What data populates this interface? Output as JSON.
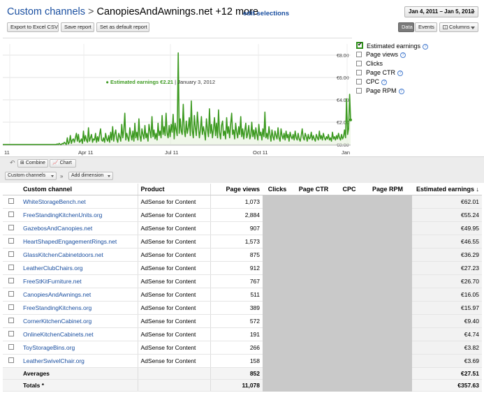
{
  "header": {
    "breadcrumb_root": "Custom channels",
    "breadcrumb_sep": ">",
    "breadcrumb_current": "CanopiesAndAwnings.net +12 more",
    "edit_link": "edit selections",
    "date_range": "Jan 4, 2011 – Jan 5, 2012"
  },
  "toolbar": {
    "export_label": "Export to Excel CSV",
    "save_label": "Save report",
    "default_label": "Set as default report",
    "data_tab": "Data",
    "events_tab": "Events",
    "columns_label": "Columns"
  },
  "chart_legend": {
    "metric": "● Estimated earnings €2.21",
    "date": "| January 3, 2012"
  },
  "metrics": [
    {
      "label": "Estimated earnings",
      "checked": true,
      "help": true
    },
    {
      "label": "Page views",
      "checked": false,
      "help": true
    },
    {
      "label": "Clicks",
      "checked": false,
      "help": false
    },
    {
      "label": "Page CTR",
      "checked": false,
      "help": true
    },
    {
      "label": "CPC",
      "checked": false,
      "help": true
    },
    {
      "label": "Page RPM",
      "checked": false,
      "help": true
    }
  ],
  "toolbar2": {
    "combine_label": "Combine",
    "chart_label": "Chart",
    "dimension_label": "Custom channels",
    "add_dimension_label": "Add dimension",
    "arrow": "»"
  },
  "table": {
    "columns": [
      "Custom channel",
      "Product",
      "Page views",
      "Clicks",
      "Page CTR",
      "CPC",
      "Page RPM",
      "Estimated earnings ↓"
    ],
    "rows": [
      {
        "channel": "WhiteStorageBench.net",
        "product": "AdSense for Content",
        "views": "1,073",
        "earnings": "€62.01"
      },
      {
        "channel": "FreeStandingKitchenUnits.org",
        "product": "AdSense for Content",
        "views": "2,884",
        "earnings": "€55.24"
      },
      {
        "channel": "GazebosAndCanopies.net",
        "product": "AdSense for Content",
        "views": "907",
        "earnings": "€49.95"
      },
      {
        "channel": "HeartShapedEngagementRings.net",
        "product": "AdSense for Content",
        "views": "1,573",
        "earnings": "€46.55"
      },
      {
        "channel": "GlassKitchenCabinetdoors.net",
        "product": "AdSense for Content",
        "views": "875",
        "earnings": "€36.29"
      },
      {
        "channel": "LeatherClubChairs.org",
        "product": "AdSense for Content",
        "views": "912",
        "earnings": "€27.23"
      },
      {
        "channel": "FreeStKitFurniture.net",
        "product": "AdSense for Content",
        "views": "767",
        "earnings": "€26.70"
      },
      {
        "channel": "CanopiesAndAwnings.net",
        "product": "AdSense for Content",
        "views": "511",
        "earnings": "€16.05"
      },
      {
        "channel": "FreeStandingKitchens.org",
        "product": "AdSense for Content",
        "views": "389",
        "earnings": "€15.97"
      },
      {
        "channel": "CornerKitchenCabinet.org",
        "product": "AdSense for Content",
        "views": "572",
        "earnings": "€9.40"
      },
      {
        "channel": "OnlineKitchenCabinets.net",
        "product": "AdSense for Content",
        "views": "191",
        "earnings": "€4.74"
      },
      {
        "channel": "ToyStorageBins.org",
        "product": "AdSense for Content",
        "views": "266",
        "earnings": "€3.82"
      },
      {
        "channel": "LeatherSwivelChair.org",
        "product": "AdSense for Content",
        "views": "158",
        "earnings": "€3.69"
      }
    ],
    "averages": {
      "label": "Averages",
      "views": "852",
      "earnings": "€27.51"
    },
    "totals": {
      "label": "Totals *",
      "views": "11,078",
      "earnings": "€357.63"
    }
  },
  "chart_data": {
    "type": "area",
    "title": "",
    "xlabel": "",
    "ylabel": "",
    "x_tick_labels": [
      "11",
      "Apr 11",
      "Jul 11",
      "Oct 11",
      "Jan"
    ],
    "y_tick_labels": [
      "€0.00",
      "€2.00",
      "€4.00",
      "€6.00",
      "€8.00"
    ],
    "ylim": [
      0,
      9
    ],
    "grid": true,
    "series": [
      {
        "values": [
          0,
          0,
          0,
          0,
          0,
          0,
          0,
          0,
          0,
          0,
          0,
          0,
          0,
          0,
          0,
          0,
          0,
          0,
          0,
          0,
          0,
          0,
          0,
          0,
          0,
          0,
          0,
          0,
          0,
          0,
          0,
          0,
          0,
          0,
          0,
          0,
          0,
          0,
          0,
          0,
          0,
          0,
          0,
          0,
          0,
          0,
          0,
          0,
          0,
          0,
          0,
          0,
          0,
          0,
          0.05,
          0,
          0.1,
          0,
          0,
          0.1,
          0.05,
          0.2,
          0.1,
          0,
          0.6,
          0.05,
          0.2,
          0.8,
          0.1,
          0.4,
          0.5,
          0.2,
          0.6,
          1.0,
          0.3,
          0.9,
          0.2,
          0.3,
          0.5,
          0.1,
          1.2,
          0.3,
          0.8,
          0.4,
          0.2,
          1.5,
          0.3,
          0.6,
          0.9,
          0.2,
          0.5,
          0.4,
          1.0,
          0.2,
          0.7,
          0.3,
          0.9,
          1.4,
          0.4,
          0.3,
          0.6,
          0.2,
          1.0,
          0.5,
          0.3,
          0.8,
          0.2,
          1.1,
          0.4,
          1.6,
          0.3,
          0.9,
          1.3,
          0.5,
          0.2,
          1.0,
          0.7,
          0.3,
          1.8,
          0.6,
          1.2,
          2.8,
          0.4,
          1.0,
          0.6,
          0.3,
          1.5,
          0.9,
          0.4,
          1.2,
          0.3,
          1.9,
          0.6,
          1.1,
          0.4,
          2.3,
          0.8,
          0.3,
          1.4,
          0.9,
          0.5,
          1.7,
          0.6,
          1.0,
          0.3,
          1.8,
          1.2,
          0.6,
          2.5,
          0.7,
          1.3,
          0.5,
          1.0,
          0.4,
          1.9,
          0.8,
          1.2,
          0.6,
          2.6,
          0.9,
          1.6,
          0.8,
          2.8,
          1.0,
          0.6,
          1.7,
          0.7,
          1.8,
          1.1,
          2.7,
          0.5,
          1.9,
          1.3,
          0.8,
          8.2,
          1.0,
          2.3,
          1.2,
          0.9,
          3.6,
          1.3,
          0.7,
          2.1,
          1.0,
          1.5,
          2.4,
          0.8,
          3.9,
          1.2,
          0.6,
          2.6,
          1.5,
          0.8,
          2.9,
          1.7,
          0.6,
          1.3,
          2.5,
          0.9,
          1.6,
          1.1,
          0.4,
          2.3,
          1.4,
          0.7,
          3.2,
          1.0,
          1.8,
          0.6,
          1.4,
          2.4,
          0.8,
          1.9,
          0.6,
          3.1,
          1.1,
          0.5,
          1.7,
          2.1,
          0.8,
          1.2,
          0.5,
          2.4,
          1.0,
          1.6,
          0.6,
          1.8,
          2.8,
          0.9,
          1.3,
          0.5,
          1.9,
          1.1,
          0.6,
          1.6,
          0.9,
          2.5,
          0.7,
          1.4,
          0.5,
          1.2,
          1.9,
          0.6,
          1.0,
          1.7,
          0.5,
          0.8,
          2.0,
          0.7,
          1.3,
          0.5,
          1.5,
          0.9,
          0.4,
          1.8,
          0.8,
          1.1,
          0.4,
          1.4,
          0.7,
          2.9,
          0.6,
          1.0,
          0.5,
          1.6,
          0.9,
          0.3,
          1.3,
          0.7,
          0.4,
          1.2,
          0.8,
          0.5,
          1.5,
          0.6,
          0.3,
          1.4,
          0.8,
          0.5,
          1.0,
          0.4,
          1.2,
          0.6,
          0.9,
          0.3,
          1.1,
          0.7,
          0.5,
          0.9,
          0.4,
          1.2,
          0.6,
          0.4,
          1.0,
          0.5,
          0.3,
          0.8,
          1.4,
          0.6,
          0.4,
          1.0,
          0.7,
          0.3,
          0.9,
          0.5,
          0.6,
          1.1,
          0.4,
          0.8,
          0.5,
          0.3,
          0.9,
          0.6,
          0.4,
          1.2,
          0.5,
          0.8,
          0.4,
          1.0,
          0.6,
          0.4,
          0.7,
          0.5,
          0.9,
          0.4,
          0.6,
          0.3,
          1.1,
          0.5,
          0.7,
          0.4,
          0.8,
          0.5,
          1.0,
          0.6,
          0.4,
          0.9,
          0.5,
          0.7,
          1.3,
          0.6,
          4.1,
          0.9,
          1.4,
          4.5,
          2.2
        ]
      }
    ]
  }
}
